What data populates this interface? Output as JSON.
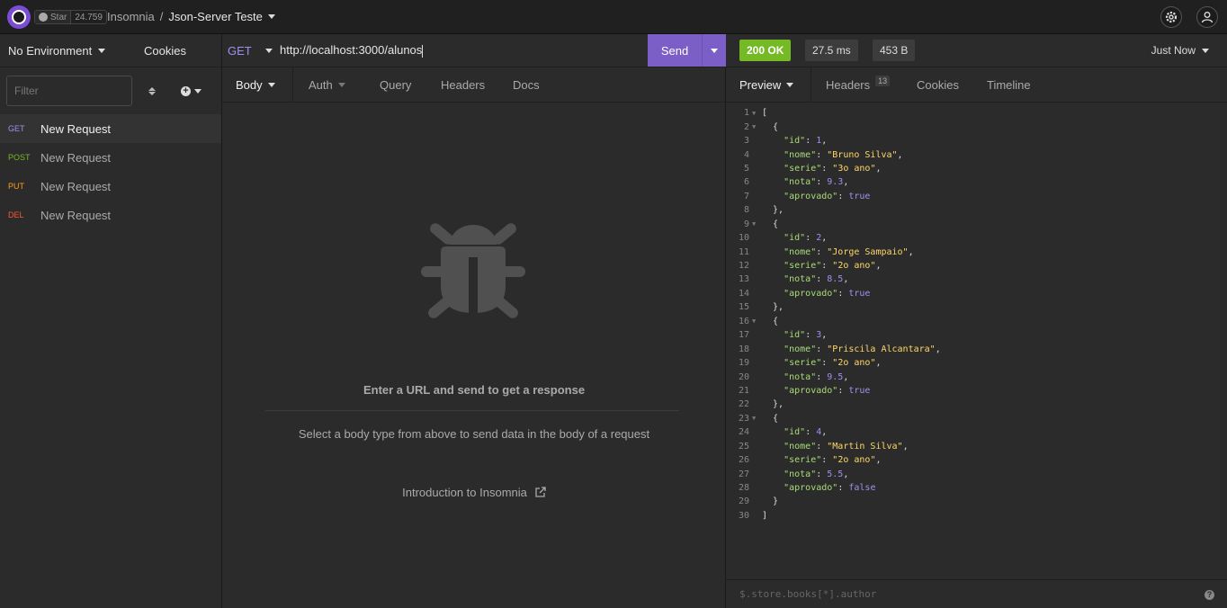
{
  "topbar": {
    "github": {
      "star_label": "Star",
      "star_count": "24.759"
    },
    "breadcrumb": {
      "app": "Insomnia",
      "separator": "/",
      "workspace": "Json-Server Teste"
    },
    "icons": [
      "settings-icon",
      "account-icon"
    ]
  },
  "sidebar": {
    "environment": "No Environment",
    "cookies": "Cookies",
    "filter_placeholder": "Filter",
    "requests": [
      {
        "method": "GET",
        "name": "New Request"
      },
      {
        "method": "POST",
        "name": "New Request"
      },
      {
        "method": "PUT",
        "name": "New Request"
      },
      {
        "method": "DEL",
        "name": "New Request"
      }
    ]
  },
  "request": {
    "method": "GET",
    "url": "http://localhost:3000/alunos",
    "send": "Send",
    "tabs": {
      "body": "Body",
      "auth": "Auth",
      "query": "Query",
      "headers": "Headers",
      "docs": "Docs"
    },
    "empty": {
      "title": "Enter a URL and send to get a response",
      "subtitle": "Select a body type from above to send data in the body of a request",
      "link": "Introduction to Insomnia"
    }
  },
  "response": {
    "status": "200 OK",
    "time": "27.5 ms",
    "size": "453 B",
    "when": "Just Now",
    "tabs": {
      "preview": "Preview",
      "headers": "Headers",
      "headers_count": "13",
      "cookies": "Cookies",
      "timeline": "Timeline"
    },
    "json_lines": [
      "[",
      "  {",
      "    \"id\": 1,",
      "    \"nome\": \"Bruno Silva\",",
      "    \"serie\": \"3o ano\",",
      "    \"nota\": 9.3,",
      "    \"aprovado\": true",
      "  },",
      "  {",
      "    \"id\": 2,",
      "    \"nome\": \"Jorge Sampaio\",",
      "    \"serie\": \"2o ano\",",
      "    \"nota\": 8.5,",
      "    \"aprovado\": true",
      "  },",
      "  {",
      "    \"id\": 3,",
      "    \"nome\": \"Priscila Alcantara\",",
      "    \"serie\": \"2o ano\",",
      "    \"nota\": 9.5,",
      "    \"aprovado\": true",
      "  },",
      "  {",
      "    \"id\": 4,",
      "    \"nome\": \"Martin Silva\",",
      "    \"serie\": \"2o ano\",",
      "    \"nota\": 5.5,",
      "    \"aprovado\": false",
      "  }",
      "]"
    ],
    "jsonpath_placeholder": "$.store.books[*].author"
  },
  "colors": {
    "accent": "#7b5fc7",
    "ok": "#75ba24",
    "get": "#a38ef0",
    "post": "#75ba24",
    "put": "#ff9a1f",
    "del": "#ff5631"
  }
}
